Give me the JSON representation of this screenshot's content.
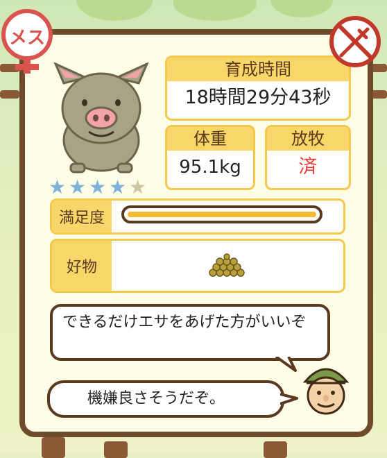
{
  "gender_badge": {
    "label": "メス",
    "color": "#d9534f"
  },
  "status_icon": {
    "name": "syringe-prohibited-icon",
    "color": "#c0392b"
  },
  "pig": {
    "rating": 4,
    "rating_max": 5
  },
  "rearing_time": {
    "label": "育成時間",
    "value": "18時間29分43秒"
  },
  "weight": {
    "label": "体重",
    "value": "95.1kg"
  },
  "grazing": {
    "label": "放牧",
    "value": "済",
    "value_color": "#e53935"
  },
  "satisfaction": {
    "label": "満足度",
    "level": 1.0
  },
  "favorite": {
    "label": "好物",
    "item_icon": "feed-pellets-icon"
  },
  "dialogue": {
    "advice": "できるだけエサをあげた方がいいぞ",
    "mood": "機嫌良さそうだぞ。"
  },
  "npc": {
    "icon": "farmer-avatar-icon"
  }
}
